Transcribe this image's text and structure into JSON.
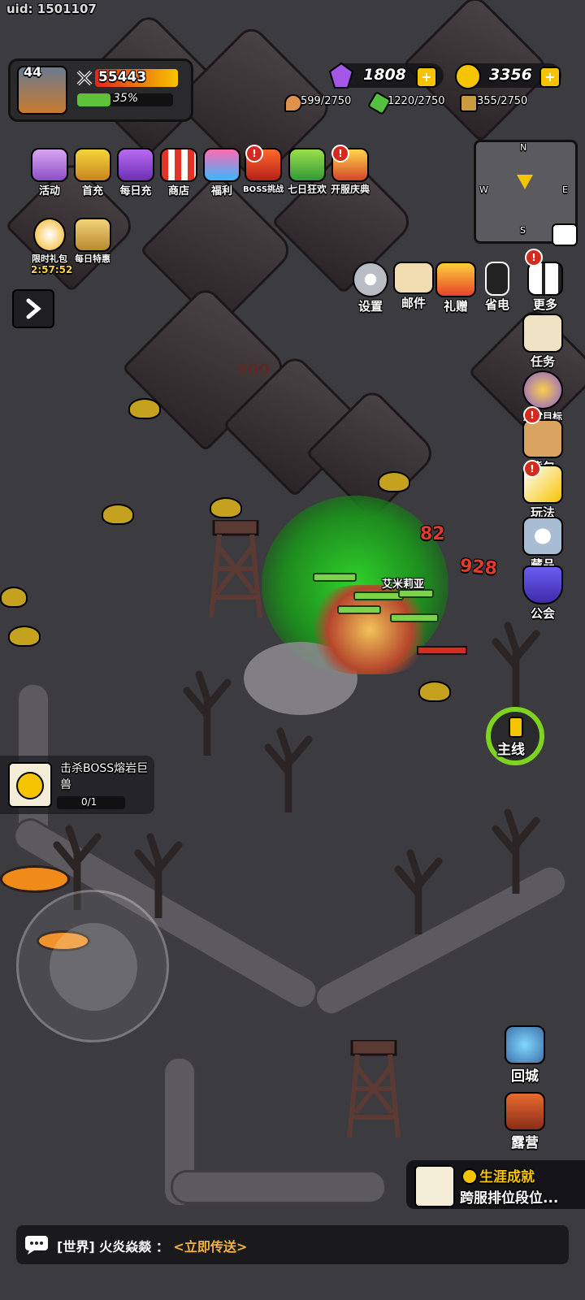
{
  "uid": "uid: 1501107",
  "player": {
    "level": "44",
    "power": "55443",
    "exp_percent": "35%",
    "exp_fraction": 0.35
  },
  "currency": {
    "gems": "1808",
    "gold": "3356"
  },
  "resources": {
    "meat": "599/2750",
    "wood": "1220/2750",
    "ore": "355/2750"
  },
  "top_menu": [
    {
      "label": "活动",
      "icon": "chest-icon"
    },
    {
      "label": "首充",
      "icon": "crown-icon"
    },
    {
      "label": "每日充",
      "icon": "gem-pile-icon"
    },
    {
      "label": "商店",
      "icon": "shop-icon"
    },
    {
      "label": "福利",
      "icon": "gift-icon"
    },
    {
      "label": "BOSS挑战",
      "icon": "demon-icon"
    },
    {
      "label": "七日狂欢",
      "icon": "monster-icon"
    },
    {
      "label": "开服庆典",
      "icon": "celebration-icon"
    }
  ],
  "timed_menu": [
    {
      "label": "限时礼包",
      "icon": "stopwatch-icon"
    },
    {
      "label": "每日特惠",
      "icon": "scale-icon"
    }
  ],
  "timer": "2:57:52",
  "minimap": {
    "n": "N",
    "w": "W",
    "e": "E",
    "s": "S"
  },
  "utility": [
    {
      "label": "设置",
      "icon": "gear-icon"
    },
    {
      "label": "邮件",
      "icon": "mail-icon"
    },
    {
      "label": "礼赠",
      "icon": "present-icon"
    },
    {
      "label": "省电",
      "icon": "battery-icon"
    },
    {
      "label": "更多",
      "icon": "grid-icon"
    }
  ],
  "side": [
    {
      "label": "任务",
      "icon": "scroll-icon"
    },
    {
      "label": "成就目标",
      "icon": "trophy-icon"
    },
    {
      "label": "背包",
      "icon": "backpack-icon"
    },
    {
      "label": "玩法",
      "icon": "sword-icon"
    },
    {
      "label": "藏品",
      "icon": "star-badge-icon"
    },
    {
      "label": "公会",
      "icon": "shield-icon"
    }
  ],
  "damage": {
    "a": "82",
    "b": "928",
    "faded": "900"
  },
  "hero_name": "艾米莉亚",
  "quest": {
    "title": "击杀BOSS熔岩巨兽",
    "progress": "0/1"
  },
  "mainline": "主线",
  "return_city": "回城",
  "camp": "露营",
  "achievement": {
    "title": "生涯成就",
    "subtitle": "跨服排位段位..."
  },
  "chat": {
    "channel": "[世界]",
    "user": "火炎焱燚",
    "sep": "：",
    "message": "<立即传送>"
  },
  "colors": {
    "accent": "#f5c400",
    "exp": "#5ec238",
    "chat_link": "#f0b341",
    "red": "#e03b2d"
  }
}
